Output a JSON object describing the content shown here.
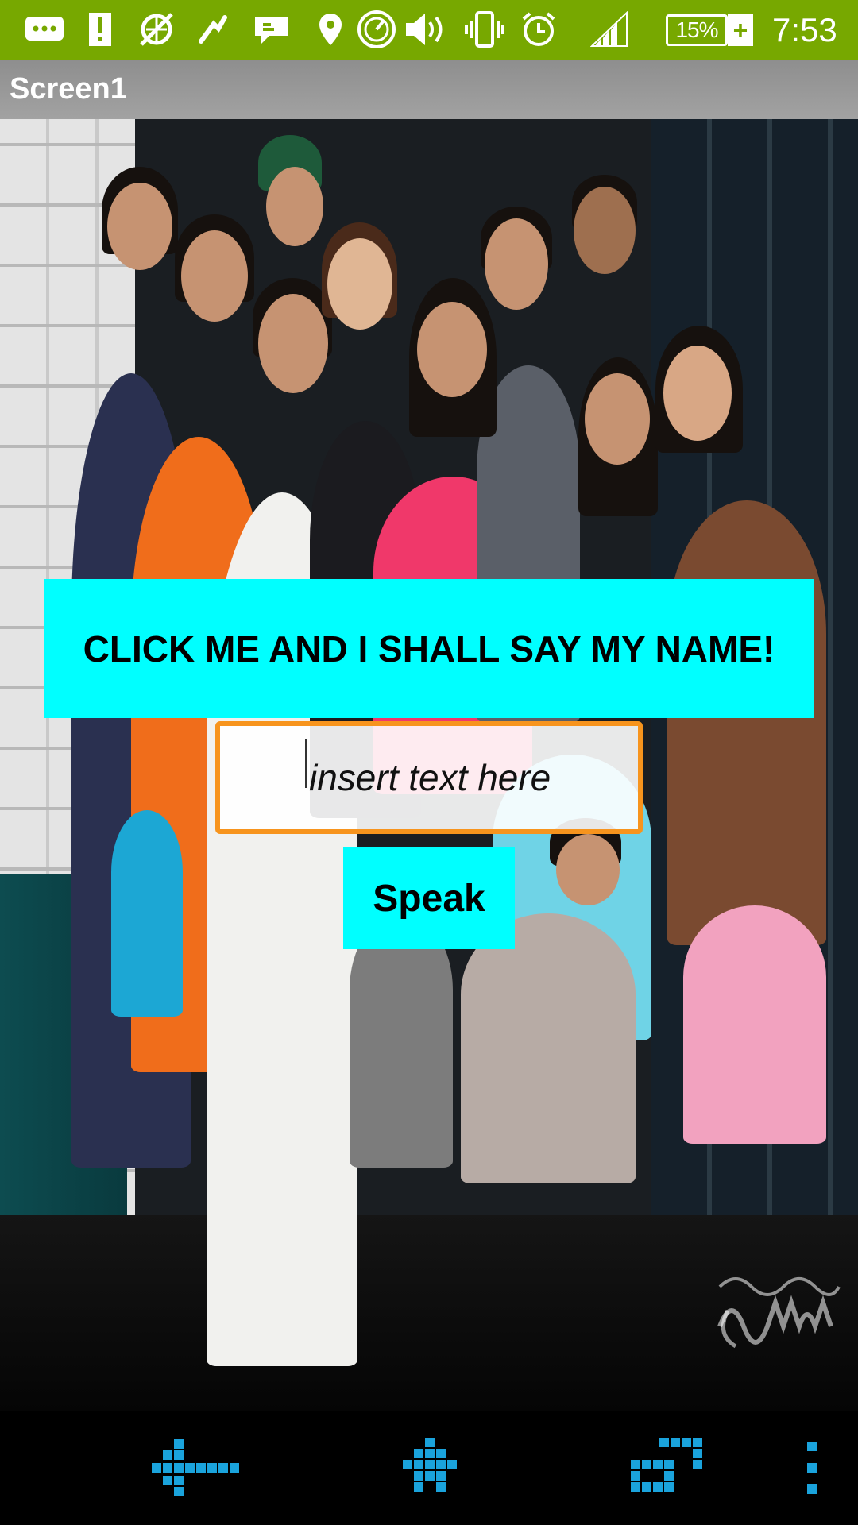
{
  "status_bar": {
    "icons": [
      "messages-icon",
      "alert-icon",
      "no-sync-icon",
      "phone-icon",
      "chat-icon",
      "location-icon",
      "speedometer-icon",
      "volume-icon",
      "vibrate-icon",
      "alarm-icon",
      "signal-icon"
    ],
    "battery": "15%",
    "time": "7:53",
    "color": "#77a800"
  },
  "app": {
    "title": "Screen1"
  },
  "main": {
    "background_image": "group-photo",
    "click_button_label": "CLICK ME AND I SHALL SAY MY NAME!",
    "text_input": {
      "value": "",
      "placeholder": "insert text here"
    },
    "speak_button_label": "Speak",
    "button_color": "#00ffff",
    "input_border_color": "#f7941d"
  },
  "nav_bar": {
    "icons": [
      "back-icon",
      "home-icon",
      "recents-icon",
      "menu-icon"
    ],
    "color": "#1aa3dc"
  }
}
